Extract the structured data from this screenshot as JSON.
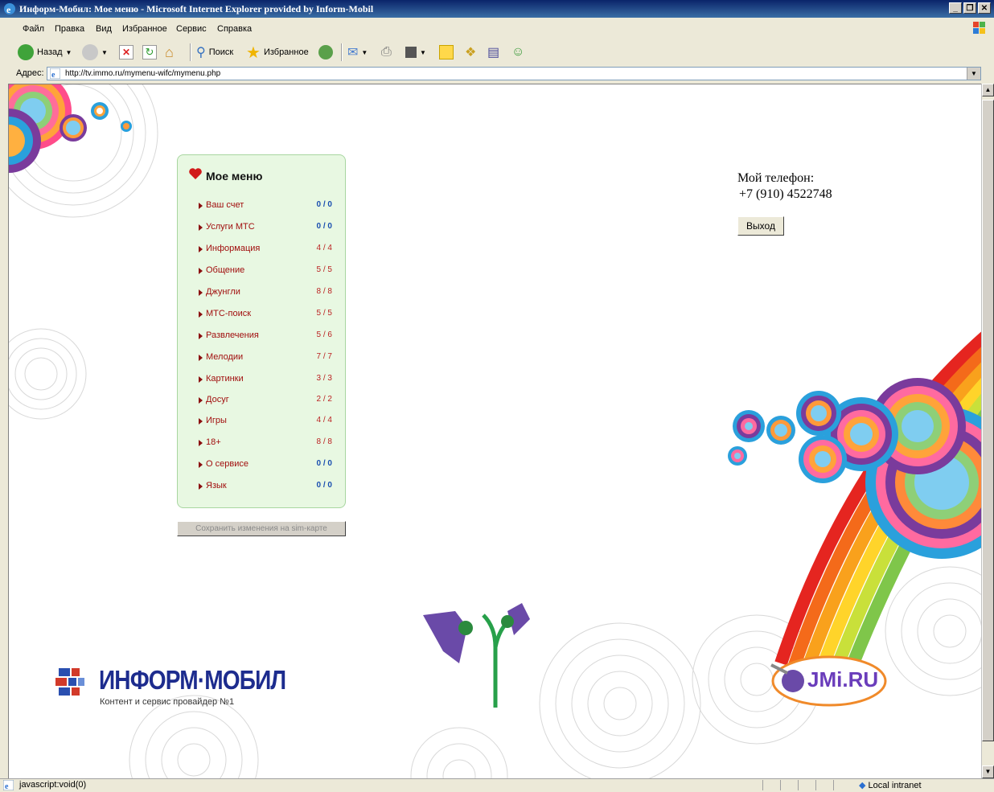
{
  "window": {
    "title": "Информ-Мобил: Мое меню - Microsoft Internet Explorer provided by Inform-Mobil",
    "controls": [
      "_",
      "❐",
      "✕"
    ]
  },
  "menubar": {
    "items": [
      "Файл",
      "Правка",
      "Вид",
      "Избранное",
      "Сервис",
      "Справка"
    ]
  },
  "toolbar": {
    "back_label": "Назад",
    "search_label": "Поиск",
    "favorites_label": "Избранное"
  },
  "address": {
    "label": "Адрес:",
    "url": "http://tv.immo.ru/mymenu-wifc/mymenu.php"
  },
  "menu": {
    "title": "Мое меню",
    "items": [
      {
        "label": "Ваш счет",
        "count": "0 / 0"
      },
      {
        "label": "Услуги МТС",
        "count": "0 / 0"
      },
      {
        "label": "Информация",
        "count": "4 / 4"
      },
      {
        "label": "Общение",
        "count": "5 / 5"
      },
      {
        "label": "Джунгли",
        "count": "8 / 8"
      },
      {
        "label": "МТС-поиск",
        "count": "5 / 5"
      },
      {
        "label": "Развлечения",
        "count": "5 / 6"
      },
      {
        "label": "Мелодии",
        "count": "7 / 7"
      },
      {
        "label": "Картинки",
        "count": "3 / 3"
      },
      {
        "label": "Досуг",
        "count": "2 / 2"
      },
      {
        "label": "Игры",
        "count": "4 / 4"
      },
      {
        "label": "18+",
        "count": "8 / 8"
      },
      {
        "label": "О сервисе",
        "count": "0 / 0"
      },
      {
        "label": "Язык",
        "count": "0 / 0"
      }
    ],
    "save_label": "Сохранить изменения на sim-карте"
  },
  "account": {
    "phone_label": "Мой телефон:",
    "phone_number": "+7 (910) 4522748",
    "logout_label": "Выход"
  },
  "brand": {
    "name": "ИНФОРМ·МОБИЛ",
    "tagline": "Контент и сервис провайдер №1",
    "partner": "JMi.RU"
  },
  "status": {
    "text": "javascript:void(0)",
    "zone": "Local intranet"
  },
  "colors": {
    "menu_bg": "#e8f8e2",
    "menu_link": "#a10e0e",
    "count_zero": "#1a4fb0",
    "brand_blue": "#1d2c8e"
  }
}
